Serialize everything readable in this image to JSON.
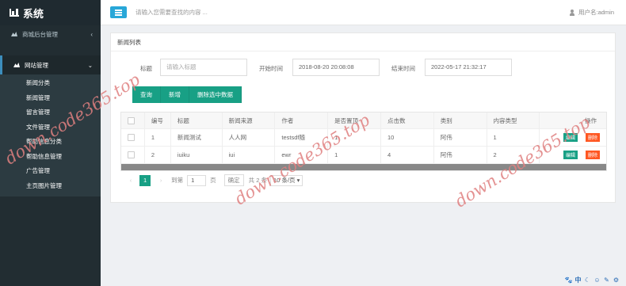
{
  "sidebar": {
    "title": "系统",
    "menu1": {
      "label": "商城后台管理",
      "arrow": "‹"
    },
    "menu2": {
      "label": "网站管理",
      "arrow": "⌄"
    },
    "items": [
      "新闻分类",
      "新闻管理",
      "留言管理",
      "文件管理",
      "帮助信息分类",
      "帮助信息管理",
      "广告管理",
      "主页图片管理"
    ]
  },
  "header": {
    "search_placeholder": "请输入您需要查找的内容 ...",
    "user": "用户名:admin"
  },
  "panel": {
    "title": "新闻列表",
    "filters": {
      "title_label": "标题",
      "title_placeholder": "请输入标题",
      "start_label": "开始时间",
      "start_value": "2018-08-20 20:08:08",
      "end_label": "结束时间",
      "end_value": "2022-05-17 21:32:17"
    },
    "buttons": {
      "query": "查询",
      "add": "新增",
      "delete_selected": "删除选中数据"
    },
    "columns": [
      "编号",
      "标题",
      "新闻来源",
      "作者",
      "是否置顶",
      "点击数",
      "类别",
      "内容类型",
      "操作"
    ],
    "rows": [
      {
        "id": "1",
        "title": "新闻测试",
        "source": "人人网",
        "author": "testsdf随",
        "top": "1",
        "clicks": "10",
        "category": "阿伟",
        "type": "1"
      },
      {
        "id": "2",
        "title": "iuiku",
        "source": "iui",
        "author": "ewr",
        "top": "1",
        "clicks": "4",
        "category": "阿伟",
        "type": "2"
      }
    ],
    "row_actions": {
      "edit": "编辑",
      "delete": "删除"
    },
    "pager": {
      "current": "1",
      "goto_label": "到第",
      "goto_value": "1",
      "page_unit": "页",
      "confirm": "确定",
      "total": "共 2 条",
      "page_size": "10 条/页"
    }
  },
  "watermark": "down.code365.top",
  "status_icons": [
    "paw-icon",
    "中",
    "moon-icon",
    "smile-icon",
    "pen-icon",
    "gear-icon"
  ]
}
